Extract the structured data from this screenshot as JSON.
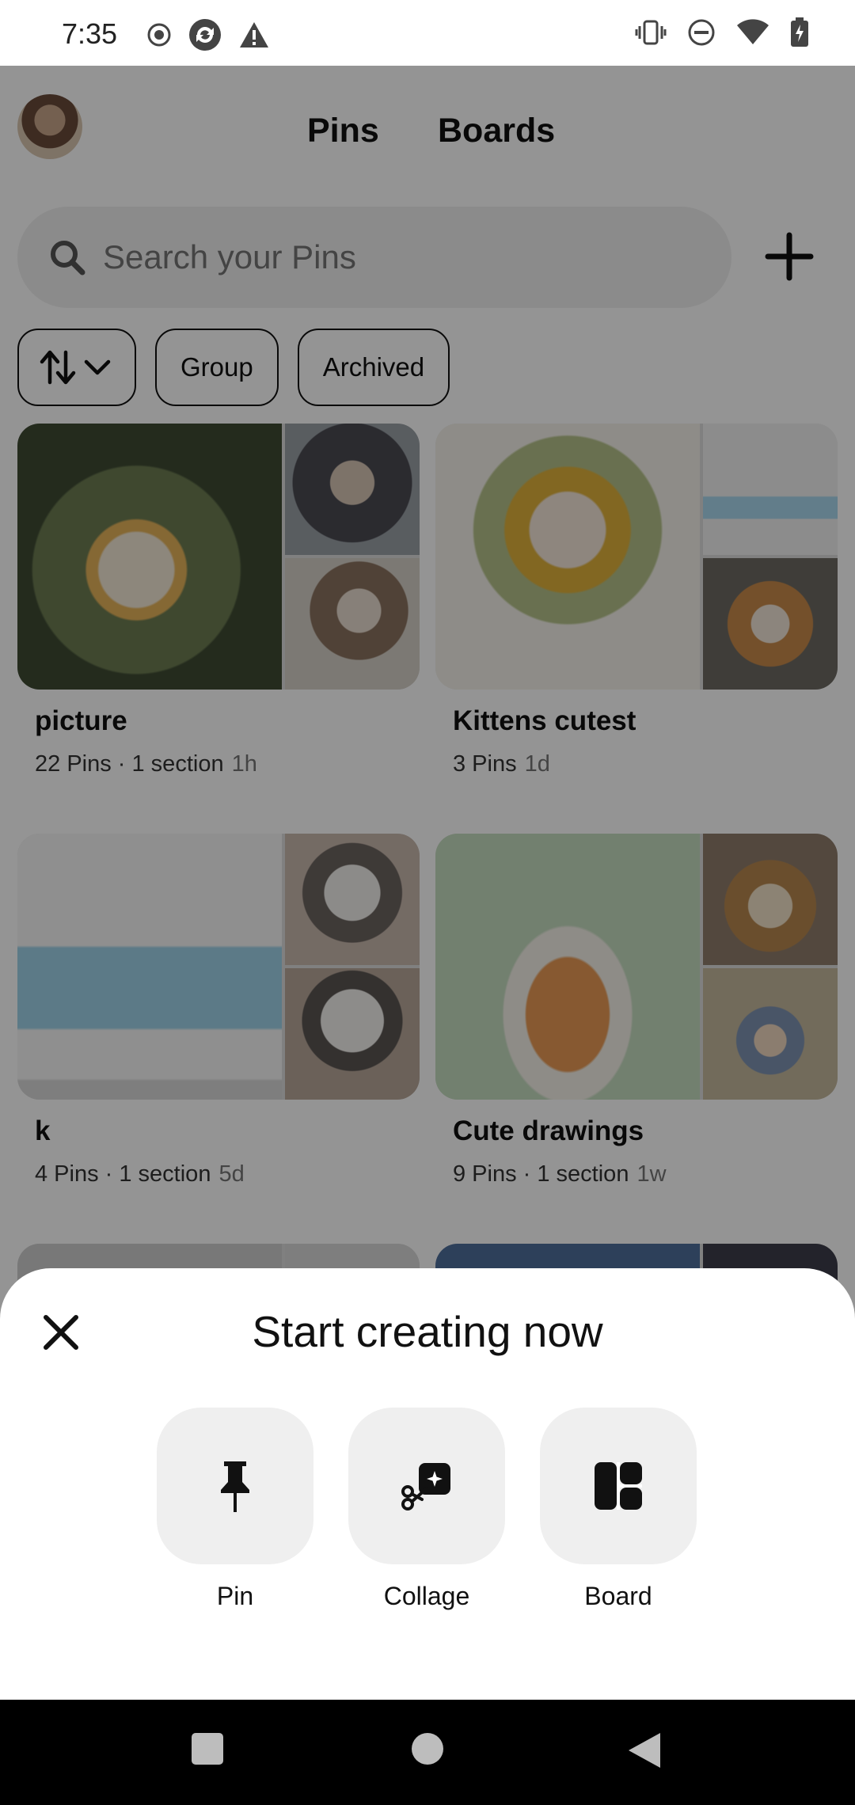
{
  "status_bar": {
    "time": "7:35"
  },
  "header": {
    "tabs": [
      {
        "label": "Pins"
      },
      {
        "label": "Boards"
      }
    ],
    "search": {
      "placeholder": "Search your Pins"
    }
  },
  "filters": {
    "chips": [
      {
        "label": "Group"
      },
      {
        "label": "Archived"
      }
    ]
  },
  "boards": [
    {
      "title": "picture",
      "meta": "22 Pins · 1 section",
      "age": "1h"
    },
    {
      "title": "Kittens cutest",
      "meta": "3 Pins",
      "age": "1d"
    },
    {
      "title": "k",
      "meta": "4 Pins · 1 section",
      "age": "5d"
    },
    {
      "title": "Cute drawings",
      "meta": "9 Pins · 1 section",
      "age": "1w"
    }
  ],
  "sheet": {
    "title": "Start creating now",
    "options": [
      {
        "label": "Pin",
        "icon": "pin-icon"
      },
      {
        "label": "Collage",
        "icon": "collage-icon"
      },
      {
        "label": "Board",
        "icon": "board-icon"
      }
    ]
  }
}
